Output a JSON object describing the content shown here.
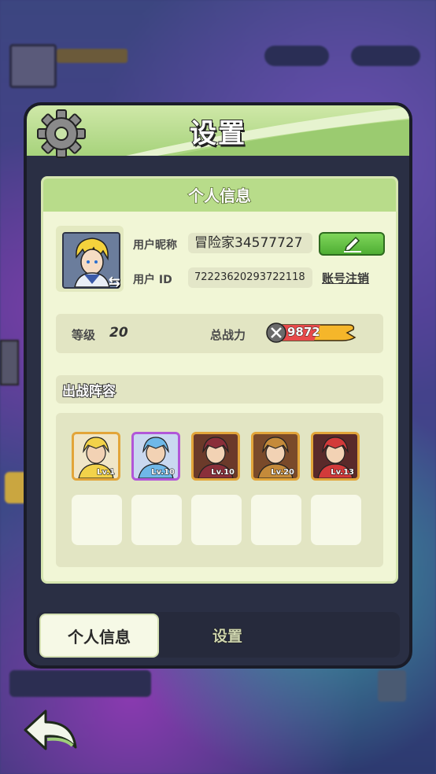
{
  "title": "设置",
  "section_title": "个人信息",
  "profile": {
    "nickname_label": "用户昵称",
    "nickname": "冒险家34577727",
    "id_label": "用户 ID",
    "id_value": "72223620293722118",
    "cancel_account": "账号注销",
    "level_label": "等级",
    "level": "20",
    "power_label": "总战力",
    "power": "9872"
  },
  "lineup": {
    "title": "出战阵容",
    "heroes": [
      {
        "level": "Lv.1",
        "frame": "#e2a53a",
        "bg": "#f0e6c8",
        "accent": "#f2d24a"
      },
      {
        "level": "Lv.10",
        "frame": "#b157d8",
        "bg": "#c9d8f0",
        "accent": "#6fb8e8"
      },
      {
        "level": "Lv.10",
        "frame": "#e2a53a",
        "bg": "#6b3a2a",
        "accent": "#8a2f3a"
      },
      {
        "level": "Lv.20",
        "frame": "#e2a53a",
        "bg": "#7a4a2a",
        "accent": "#c48a3a"
      },
      {
        "level": "Lv.13",
        "frame": "#e2a53a",
        "bg": "#5a2a2a",
        "accent": "#d23a3a"
      }
    ]
  },
  "tabs": {
    "active": "个人信息",
    "inactive": "设置"
  },
  "colors": {
    "header_green": "#b8dc8a",
    "button_green": "#4fae34",
    "panel_dark": "#2a2f44"
  }
}
